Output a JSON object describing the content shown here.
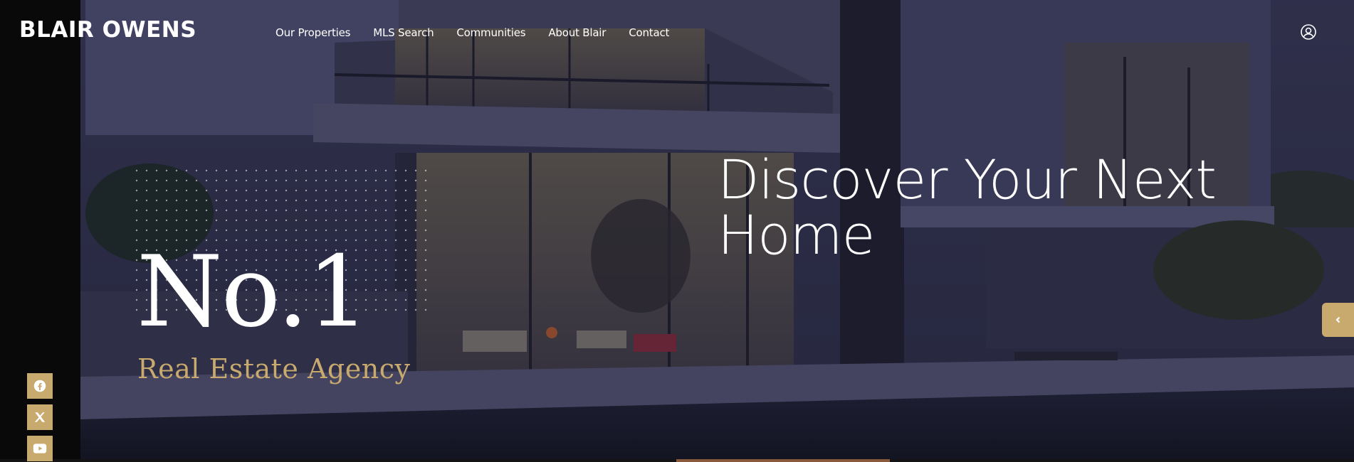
{
  "header": {
    "brand": "BLAIR OWENS",
    "nav": [
      "Our Properties",
      "MLS Search",
      "Communities",
      "About Blair",
      "Contact"
    ],
    "user_icon": "user-circle-icon"
  },
  "hero": {
    "rank": "No.1",
    "tagline": "Real Estate Agency",
    "headline_line1": "Discover Your Next",
    "headline_line2": "Home"
  },
  "social": {
    "items": [
      {
        "name": "facebook",
        "icon": "facebook-icon"
      },
      {
        "name": "x",
        "icon": "x-icon"
      },
      {
        "name": "youtube",
        "icon": "youtube-icon"
      }
    ]
  },
  "side_tab": {
    "icon": "chevron-left-icon"
  },
  "colors": {
    "accent": "#c8a96e",
    "overlay": "#2a2c45",
    "dark": "#0a0909"
  }
}
